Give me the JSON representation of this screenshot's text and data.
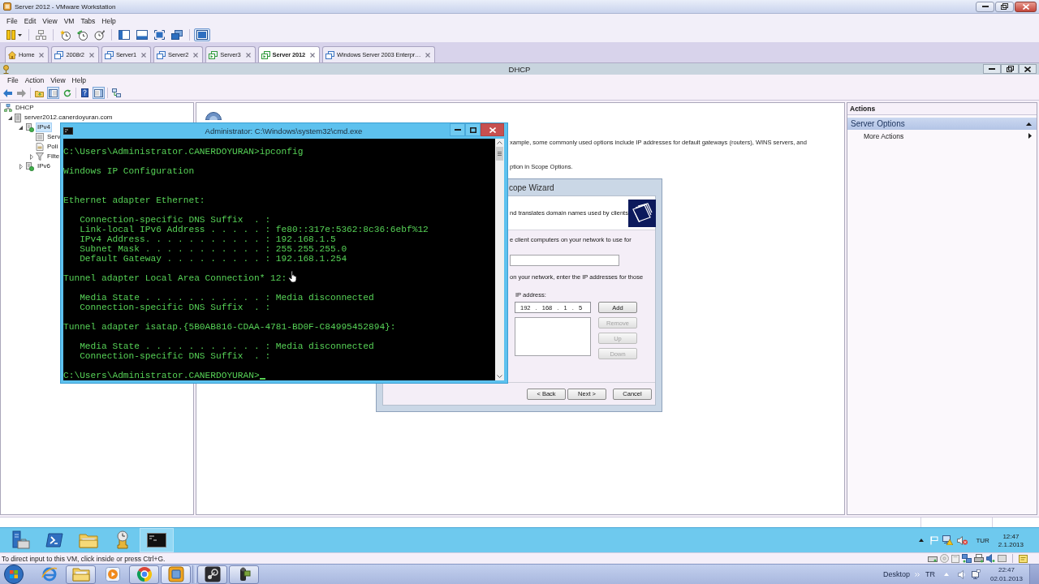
{
  "window": {
    "title": "Server 2012 - VMware Workstation"
  },
  "menu": [
    "File",
    "Edit",
    "View",
    "VM",
    "Tabs",
    "Help"
  ],
  "toolbar": [
    [
      {
        "kind": "power",
        "pressed": false
      }
    ],
    [
      {
        "kind": "sendkeys",
        "pressed": false
      }
    ],
    [
      {
        "kind": "snapshot",
        "pressed": false
      },
      {
        "kind": "revert",
        "pressed": false
      },
      {
        "kind": "manager",
        "pressed": false
      }
    ],
    [
      {
        "kind": "library",
        "pressed": false
      },
      {
        "kind": "thumbnails",
        "pressed": false
      },
      {
        "kind": "fullscreen",
        "pressed": false
      },
      {
        "kind": "unity",
        "pressed": false
      }
    ],
    [
      {
        "kind": "console",
        "pressed": true
      }
    ]
  ],
  "tabs": [
    {
      "kind": "home",
      "label": "Home",
      "selected": false
    },
    {
      "kind": "vm",
      "label": "2008r2",
      "selected": false,
      "running": false
    },
    {
      "kind": "vm",
      "label": "Server1",
      "selected": false,
      "running": false
    },
    {
      "kind": "vm",
      "label": "Server2",
      "selected": false,
      "running": false
    },
    {
      "kind": "vm",
      "label": "Server3",
      "selected": false,
      "running": true
    },
    {
      "kind": "vm",
      "label": "Server 2012",
      "selected": true,
      "running": true
    },
    {
      "kind": "vm",
      "label": "Windows Server 2003 Enterpr…",
      "selected": false,
      "running": false
    }
  ],
  "vm": {
    "mmc": {
      "title": "DHCP",
      "menu": [
        "File",
        "Action",
        "View",
        "Help"
      ],
      "toolbar": [
        [
          {
            "kind": "back",
            "disabled": false
          },
          {
            "kind": "forward",
            "disabled": true
          }
        ],
        [
          {
            "kind": "up",
            "pressed": false
          },
          {
            "kind": "tree",
            "pressed": true
          },
          {
            "kind": "refresh",
            "pressed": false
          }
        ],
        [
          {
            "kind": "help",
            "pressed": false
          },
          {
            "kind": "actionpane",
            "pressed": true
          }
        ],
        [
          {
            "kind": "network",
            "pressed": false
          }
        ]
      ],
      "tree": [
        {
          "kind": "service",
          "label": "DHCP",
          "selected": false,
          "children": [
            {
              "kind": "server",
              "label": "server2012.canerdoyuran.com",
              "selected": false,
              "expanded": true,
              "children": [
                {
                  "kind": "protocol",
                  "label": "IPv4",
                  "selected": true,
                  "expanded": true,
                  "children": [
                    {
                      "kind": "options",
                      "label": "Serv",
                      "selected": false
                    },
                    {
                      "kind": "policies",
                      "label": "Poli",
                      "selected": false
                    },
                    {
                      "kind": "filters",
                      "label": "Filte",
                      "selected": false,
                      "expanded": false
                    }
                  ]
                },
                {
                  "kind": "protocol",
                  "label": "IPv6",
                  "selected": false,
                  "expanded": false
                }
              ]
            }
          ]
        }
      ],
      "details": [
        "xample, some commonly used options include IP addresses for default gateways (routers), WINS servers, and",
        "ption in Scope Options."
      ],
      "actions": {
        "title": "Actions",
        "section": {
          "label": "Server Options",
          "expanded": true,
          "items": [
            {
              "label": "More Actions"
            }
          ]
        }
      }
    },
    "console": {
      "title": "Administrator: C:\\Windows\\system32\\cmd.exe",
      "lines": [
        {
          "kind": "prompt",
          "text": "C:\\Users\\Administrator.CANERDOYURAN>ipconfig",
          "cursor": false
        },
        {
          "kind": "blank"
        },
        {
          "kind": "text",
          "text": "Windows IP Configuration"
        },
        {
          "kind": "blank"
        },
        {
          "kind": "blank"
        },
        {
          "kind": "text",
          "text": "Ethernet adapter Ethernet:"
        },
        {
          "kind": "blank"
        },
        {
          "kind": "detail",
          "text": "Connection-specific DNS Suffix  . :"
        },
        {
          "kind": "detail",
          "text": "Link-local IPv6 Address . . . . . : fe80::317e:5362:8c36:6ebf%12"
        },
        {
          "kind": "detail",
          "text": "IPv4 Address. . . . . . . . . . . : 192.168.1.5"
        },
        {
          "kind": "detail",
          "text": "Subnet Mask . . . . . . . . . . . : 255.255.255.0"
        },
        {
          "kind": "detail",
          "text": "Default Gateway . . . . . . . . . : 192.168.1.254"
        },
        {
          "kind": "blank"
        },
        {
          "kind": "text",
          "text": "Tunnel adapter Local Area Connection* 12:"
        },
        {
          "kind": "blank"
        },
        {
          "kind": "detail",
          "text": "Media State . . . . . . . . . . . : Media disconnected"
        },
        {
          "kind": "detail",
          "text": "Connection-specific DNS Suffix  . :"
        },
        {
          "kind": "blank"
        },
        {
          "kind": "text",
          "text": "Tunnel adapter isatap.{5B0AB816-CDAA-4781-BD0F-C84995452894}:"
        },
        {
          "kind": "blank"
        },
        {
          "kind": "detail",
          "text": "Media State . . . . . . . . . . . : Media disconnected"
        },
        {
          "kind": "detail",
          "text": "Connection-specific DNS Suffix  . :"
        },
        {
          "kind": "blank"
        },
        {
          "kind": "prompt",
          "text": "C:\\Users\\Administrator.CANERDOYURAN>",
          "cursor": true
        }
      ]
    },
    "wizard": {
      "title": "cope Wizard",
      "header": "nd translates domain names used by clients",
      "intro": "e client computers on your network to use for",
      "instruction": "on your network, enter the IP addresses for those",
      "ip_label": "IP address:",
      "ip_value": "192 . 168 . 1 . 5",
      "side_buttons": [
        {
          "label": "Add",
          "disabled": false
        },
        {
          "label": "Remove",
          "disabled": true
        },
        {
          "label": "Up",
          "disabled": true
        },
        {
          "label": "Down",
          "disabled": true
        }
      ],
      "footer_buttons": [
        {
          "label": "< Back"
        },
        {
          "label": "Next >"
        },
        {
          "label": "Cancel"
        }
      ]
    },
    "taskbar": {
      "apps": [
        {
          "kind": "manager",
          "selected": false
        },
        {
          "kind": "shell",
          "selected": false
        },
        {
          "kind": "folder",
          "selected": false
        },
        {
          "kind": "tools",
          "selected": false
        },
        {
          "kind": "console",
          "selected": true
        }
      ],
      "language": "TUR",
      "time": "12:47",
      "date": "2.1.2013"
    }
  },
  "status_bar": {
    "text": "To direct input to this VM, click inside or press Ctrl+G."
  },
  "host_taskbar": {
    "app_groups": [
      [
        {
          "kind": "browser",
          "running": false,
          "selected": false
        },
        {
          "kind": "explorer",
          "running": true,
          "selected": false
        },
        {
          "kind": "media",
          "running": false,
          "selected": false
        },
        {
          "kind": "chrome",
          "running": true,
          "selected": false
        },
        {
          "kind": "vmware",
          "running": true,
          "selected": true
        }
      ],
      [
        {
          "kind": "steam",
          "running": true,
          "selected": false
        },
        {
          "kind": "camera",
          "running": true,
          "selected": false
        }
      ]
    ],
    "toolbar": "Desktop",
    "language": "TR",
    "time": "22:47",
    "date": "02.01.2013"
  }
}
